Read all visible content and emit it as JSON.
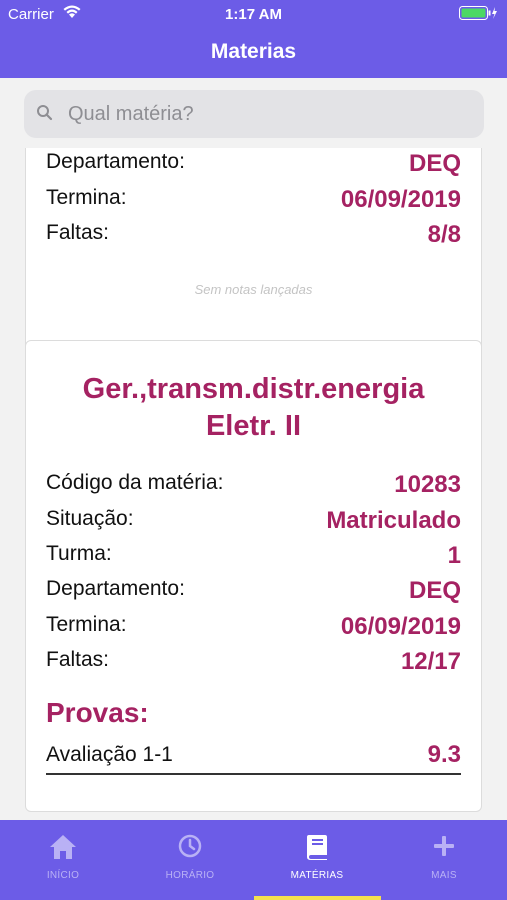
{
  "status_bar": {
    "carrier": "Carrier",
    "time": "1:17 AM"
  },
  "nav": {
    "title": "Materias"
  },
  "search": {
    "placeholder": "Qual matéria?"
  },
  "card1": {
    "rows": [
      {
        "label": "Departamento:",
        "value": "DEQ"
      },
      {
        "label": "Termina:",
        "value": "06/09/2019"
      },
      {
        "label": "Faltas:",
        "value": "8/8"
      }
    ],
    "empty_notes": "Sem notas lançadas"
  },
  "card2": {
    "title_line1": "Ger.,transm.distr.energia",
    "title_line2": "Eletr. II",
    "rows": [
      {
        "label": "Código da matéria:",
        "value": "10283"
      },
      {
        "label": "Situação:",
        "value": "Matriculado"
      },
      {
        "label": "Turma:",
        "value": "1"
      },
      {
        "label": "Departamento:",
        "value": "DEQ"
      },
      {
        "label": "Termina:",
        "value": "06/09/2019"
      },
      {
        "label": "Faltas:",
        "value": "12/17"
      }
    ],
    "provas_title": "Provas:",
    "exams": [
      {
        "label": "Avaliação 1-1",
        "value": "9.3"
      }
    ]
  },
  "tabs": [
    {
      "label": "INÍCIO",
      "icon": "home-icon",
      "active": false
    },
    {
      "label": "HORÁRIO",
      "icon": "clock-icon",
      "active": false
    },
    {
      "label": "MATÉRIAS",
      "icon": "book-icon",
      "active": true
    },
    {
      "label": "MAIS",
      "icon": "plus-icon",
      "active": false
    }
  ],
  "colors": {
    "primary": "#6c5ce7",
    "accent": "#a52262",
    "tab_indicator": "#f4e04d"
  }
}
